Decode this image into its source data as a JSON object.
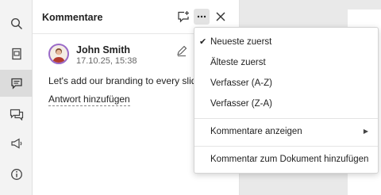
{
  "panel": {
    "title": "Kommentare"
  },
  "comment": {
    "author": "John Smith",
    "date": "17.10.25, 15:38",
    "text": "Let's add our branding to every slide",
    "reply_label": "Antwort hinzufügen"
  },
  "menu": {
    "items": [
      {
        "label": "Neueste zuerst",
        "checked": true
      },
      {
        "label": "Älteste zuerst"
      },
      {
        "label": "Verfasser (A-Z)"
      },
      {
        "label": "Verfasser (Z-A)"
      },
      {
        "label": "Kommentare anzeigen",
        "submenu": true
      },
      {
        "label": "Kommentar zum Dokument hinzufügen"
      }
    ],
    "check_glyph": "✔",
    "submenu_glyph": "▶"
  },
  "icons": {
    "rail": [
      "search-icon",
      "slides-icon",
      "comments-icon",
      "chat-icon",
      "announcement-icon",
      "info-icon"
    ],
    "header": [
      "add-comment-icon",
      "more-icon",
      "close-icon"
    ]
  },
  "colors": {
    "avatar_ring": "#9a6ac8",
    "active_rail": "#dcdcdc"
  }
}
